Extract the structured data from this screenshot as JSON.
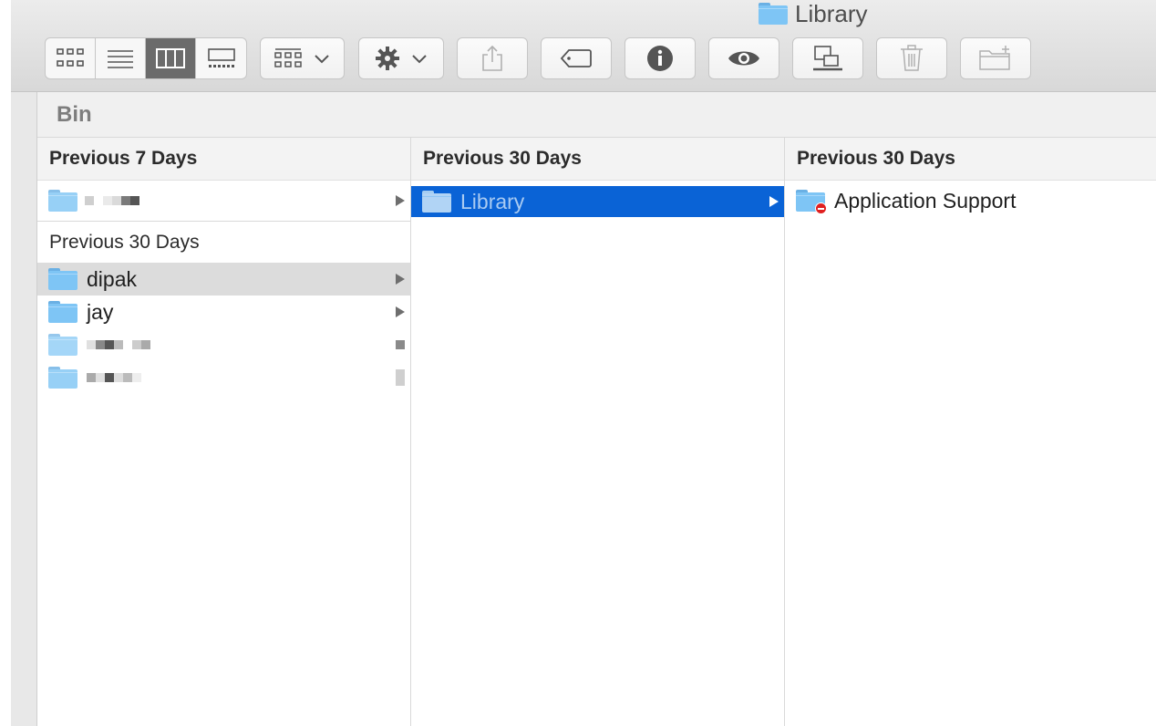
{
  "window": {
    "title": "Library"
  },
  "toolbar": {
    "view_modes": [
      "icon-view",
      "list-view",
      "column-view",
      "gallery-view"
    ],
    "active_view": "column-view",
    "buttons": [
      "group-by",
      "action",
      "share",
      "tags",
      "get-info",
      "quick-look",
      "connect-to-server",
      "trash",
      "new-folder"
    ]
  },
  "pathbar": {
    "label": "Bin"
  },
  "columns": [
    {
      "header": "Previous 7 Days",
      "section2": "Previous 30 Days",
      "items": [
        {
          "label": "dipak"
        },
        {
          "label": "jay"
        }
      ]
    },
    {
      "header": "Previous 30 Days",
      "items": [
        {
          "label": "Library"
        }
      ]
    },
    {
      "header": "Previous 30 Days",
      "items": [
        {
          "label": "Application Support"
        }
      ]
    }
  ],
  "colors": {
    "selection_blue": "#0a63d6",
    "folder_blue": "#7ec5f5",
    "selection_gray": "#dcdcdc"
  }
}
